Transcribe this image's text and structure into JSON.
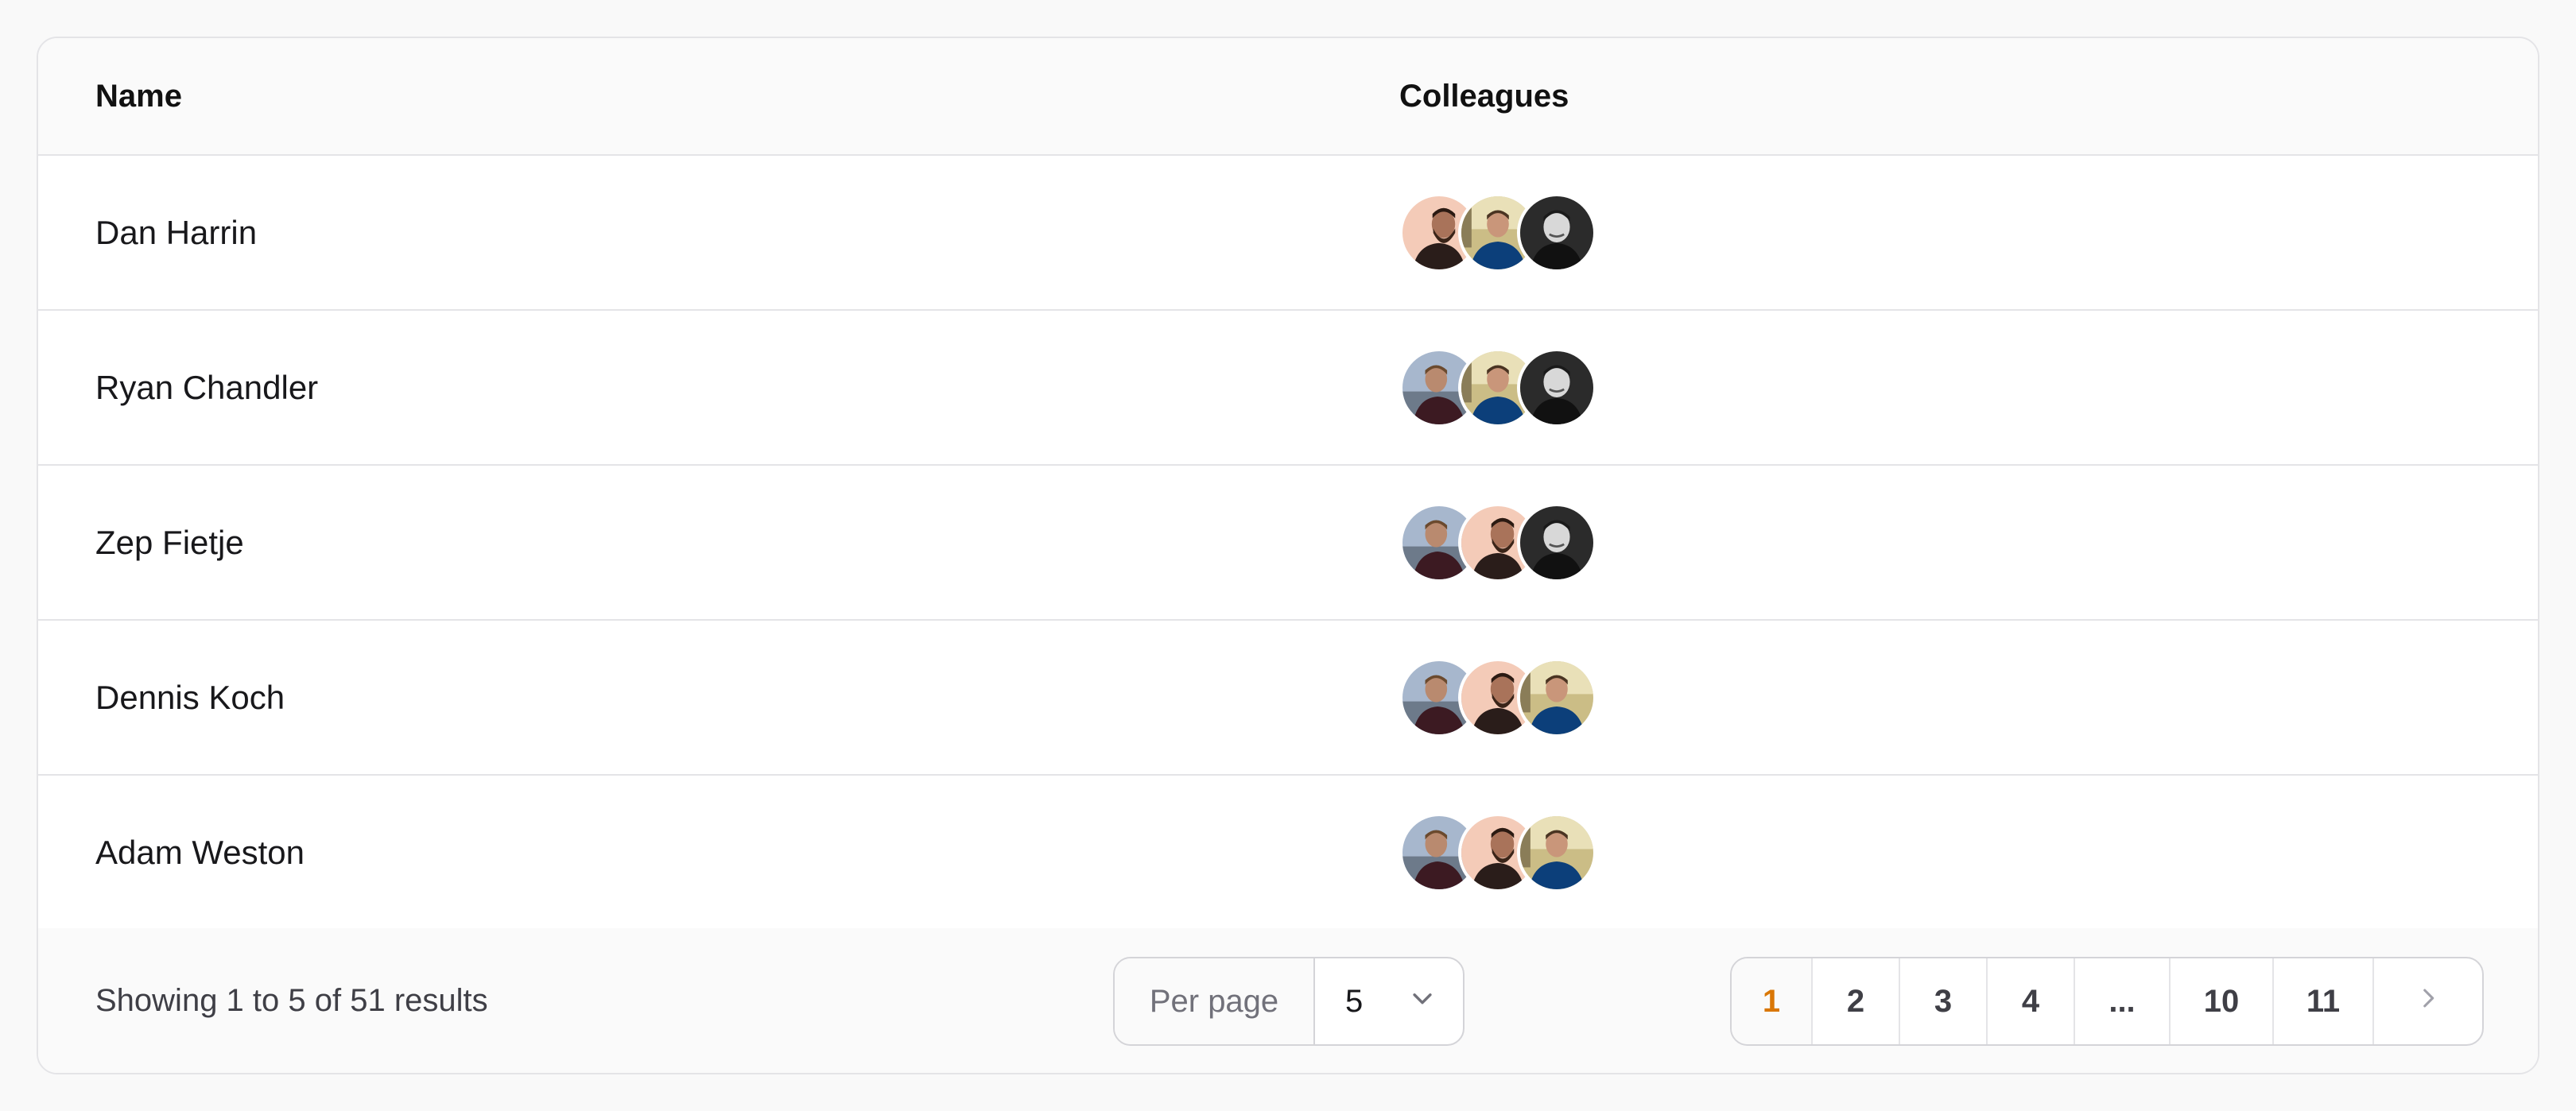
{
  "table": {
    "headers": {
      "name": "Name",
      "colleagues": "Colleagues"
    },
    "rows": [
      {
        "name": "Dan Harrin",
        "colleagues": [
          "bearded-man-peach",
          "man-blue-shirt-outdoor",
          "man-bw-portrait"
        ]
      },
      {
        "name": "Ryan Chandler",
        "colleagues": [
          "man-maroon-shirt-sky",
          "man-blue-shirt-outdoor",
          "man-bw-portrait"
        ]
      },
      {
        "name": "Zep Fietje",
        "colleagues": [
          "man-maroon-shirt-sky",
          "bearded-man-peach",
          "man-bw-portrait"
        ]
      },
      {
        "name": "Dennis Koch",
        "colleagues": [
          "man-maroon-shirt-sky",
          "bearded-man-peach",
          "man-blue-shirt-outdoor"
        ]
      },
      {
        "name": "Adam Weston",
        "colleagues": [
          "man-maroon-shirt-sky",
          "bearded-man-peach",
          "man-blue-shirt-outdoor"
        ]
      }
    ]
  },
  "footer": {
    "results_text": "Showing 1 to 5 of 51 results",
    "per_page_label": "Per page",
    "per_page_value": "5",
    "pages": [
      "1",
      "2",
      "3",
      "4",
      "...",
      "10",
      "11"
    ],
    "active_page": "1",
    "next_icon": "chevron-right-icon",
    "select_icon": "chevron-down-icon"
  },
  "colors": {
    "accent": "#d97706",
    "border": "#e4e4e7",
    "header_bg": "#fafafa"
  }
}
